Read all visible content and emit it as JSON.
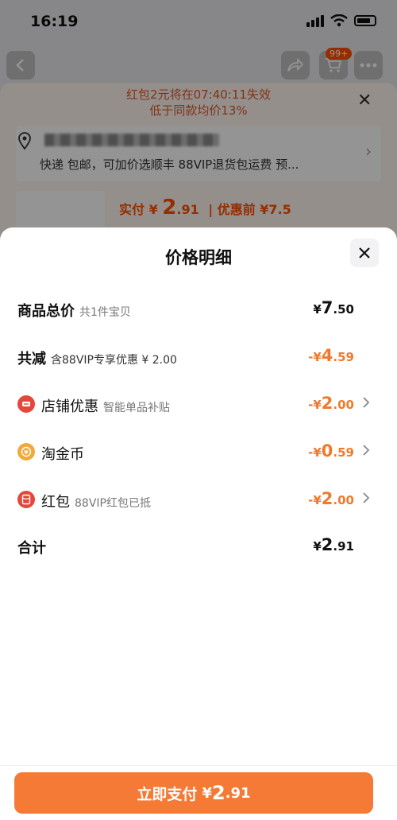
{
  "status_bar": {
    "time": "16:19"
  },
  "background_page": {
    "cart_badge": "99+",
    "redpack_notice": "红包2元将在07:40:11失效",
    "lower_price_notice": "低于同款均价13%",
    "address_detail": "快递 包邮，可加价选顺丰 88VIP退货包运费 预...",
    "price_label": "实付 ¥",
    "price_int": "2",
    "price_dec": ".91",
    "price_before": "| 优惠前 ¥7.5"
  },
  "sheet": {
    "title": "价格明细",
    "rows": [
      {
        "label": "商品总价",
        "sub": "共1件宝贝",
        "sym": "¥",
        "int": "7",
        "dec": ".50"
      },
      {
        "label": "共减",
        "sub": "含88VIP专享优惠 ¥ 2.00",
        "sym": "-¥",
        "int": "4",
        "dec": ".59"
      },
      {
        "label": "店铺优惠",
        "sub": "智能单品补贴",
        "sym": "-¥",
        "int": "2",
        "dec": ".00"
      },
      {
        "label": "淘金币",
        "sub": "",
        "sym": "-¥",
        "int": "0",
        "dec": ".59"
      },
      {
        "label": "红包",
        "sub": "88VIP红包已抵",
        "sym": "-¥",
        "int": "2",
        "dec": ".00"
      },
      {
        "label": "合计",
        "sub": "",
        "sym": "¥",
        "int": "2",
        "dec": ".91"
      }
    ]
  },
  "footer": {
    "pay_label": "立即支付",
    "pay_sym": "¥",
    "pay_int": "2",
    "pay_dec": ".91"
  },
  "colors": {
    "accent_orange": "#f47a35",
    "discount_orange": "#f07a2a",
    "store_icon_red": "#e5483b",
    "coin_icon_gold": "#f0a93a"
  }
}
